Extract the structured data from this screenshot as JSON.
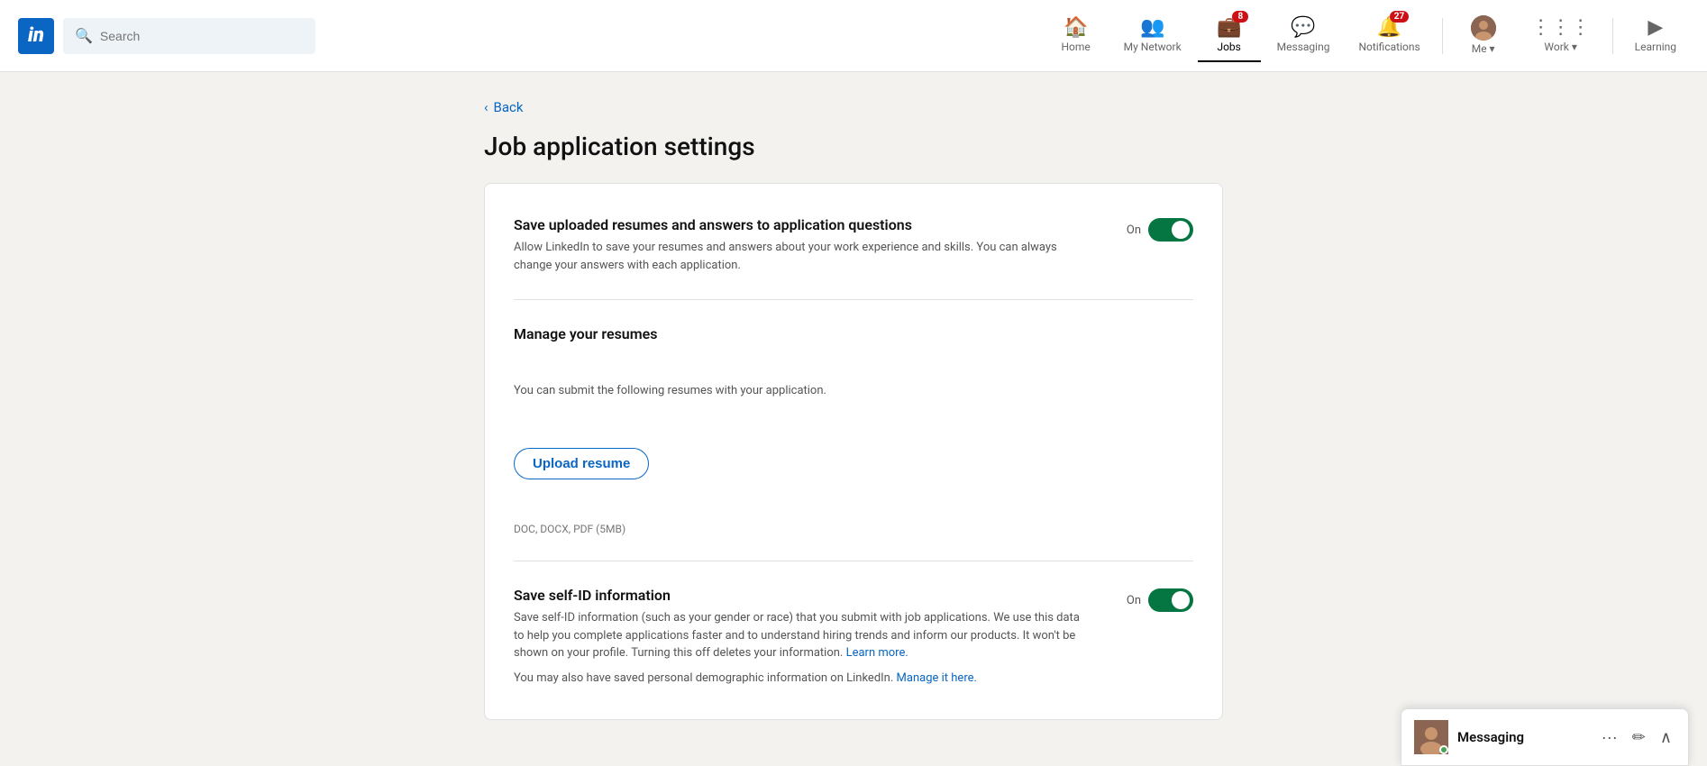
{
  "brand": {
    "logo_text": "in"
  },
  "search": {
    "placeholder": "Search"
  },
  "navbar": {
    "items": [
      {
        "id": "home",
        "label": "Home",
        "icon": "🏠",
        "badge": null,
        "active": false
      },
      {
        "id": "network",
        "label": "My Network",
        "icon": "👥",
        "badge": null,
        "active": false
      },
      {
        "id": "jobs",
        "label": "Jobs",
        "icon": "💼",
        "badge": "8",
        "active": true
      },
      {
        "id": "messaging",
        "label": "Messaging",
        "icon": "💬",
        "badge": null,
        "active": false
      },
      {
        "id": "notifications",
        "label": "Notifications",
        "icon": "🔔",
        "badge": "27",
        "active": false
      }
    ],
    "me_label": "Me",
    "me_dropdown": "▾",
    "work_label": "Work",
    "work_dropdown": "▾",
    "learning_label": "Learning"
  },
  "back": {
    "label": "Back",
    "chevron": "‹"
  },
  "page": {
    "title": "Job application settings"
  },
  "settings": {
    "save_resumes": {
      "title": "Save uploaded resumes and answers to application questions",
      "description": "Allow LinkedIn to save your resumes and answers about your work experience and skills. You can always change your answers with each application.",
      "toggle_label": "On",
      "enabled": true
    },
    "manage_resumes": {
      "title": "Manage your resumes",
      "description": "You can submit the following resumes with your application.",
      "upload_button": "Upload resume",
      "file_hint": "DOC, DOCX, PDF (5MB)"
    },
    "save_self_id": {
      "title": "Save self-ID information",
      "description": "Save self-ID information (such as your gender or race) that you submit with job applications. We use this data to help you complete applications faster and to understand hiring trends and inform our products. It won't be shown on your profile. Turning this off deletes your information.",
      "learn_more_link": "Learn more.",
      "manage_text": "You may also have saved personal demographic information on LinkedIn.",
      "manage_link": "Manage it here.",
      "toggle_label": "On",
      "enabled": true
    }
  },
  "messaging_widget": {
    "title": "Messaging",
    "ellipsis": "···",
    "compose_icon": "✏",
    "collapse_icon": "∧"
  }
}
